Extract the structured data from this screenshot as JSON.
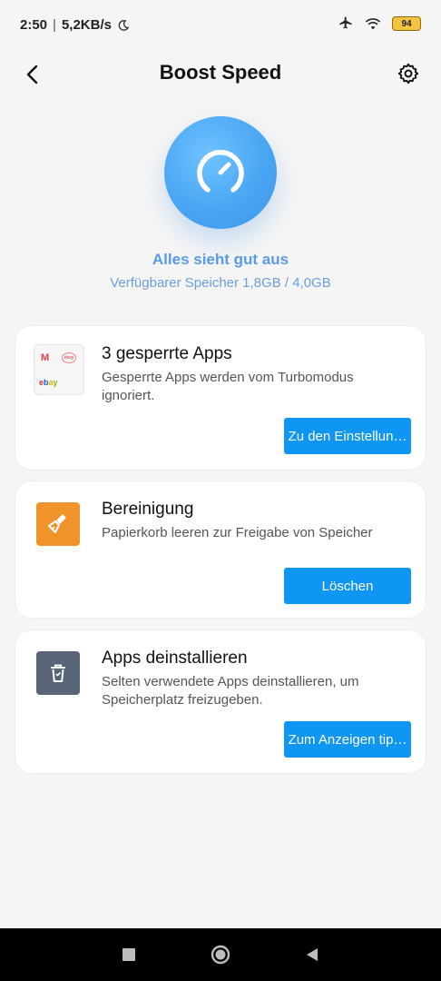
{
  "status_bar": {
    "time": "2:50",
    "separator": "|",
    "network_speed": "5,2KB/s",
    "battery_level": "94",
    "icons": [
      "moon-icon",
      "airplane-icon",
      "wifi-icon",
      "battery-icon"
    ]
  },
  "header": {
    "title": "Boost Speed",
    "back_icon": "chevron-left-icon",
    "settings_icon": "gear-icon"
  },
  "hero": {
    "icon": "speedometer-icon",
    "title": "Alles sieht gut aus",
    "subtitle": "Verfügbarer Speicher 1,8GB / 4,0GB",
    "accent_color": "#4aa6f3"
  },
  "cards": [
    {
      "title": "3 gesperrte Apps",
      "description": "Gesperrte Apps werden vom Turbomodus ignoriert.",
      "button": "Zu den Einstellun…",
      "icon": "locked-apps-icon"
    },
    {
      "title": "Bereinigung",
      "description": "Papierkorb leeren zur Freigabe von Speicher",
      "button": "Löschen",
      "icon": "broom-icon",
      "icon_color": "#f0932b"
    },
    {
      "title": "Apps deinstallieren",
      "description": "Selten verwendete Apps deinstallieren, um Speicherplatz freizugeben.",
      "button": "Zum Anzeigen tip…",
      "icon": "uninstall-icon",
      "icon_color": "#5a6478"
    }
  ],
  "button_color": "#0f96f2",
  "nav_bar": {
    "icons": [
      "recent-apps-icon",
      "home-icon",
      "back-triangle-icon"
    ]
  }
}
